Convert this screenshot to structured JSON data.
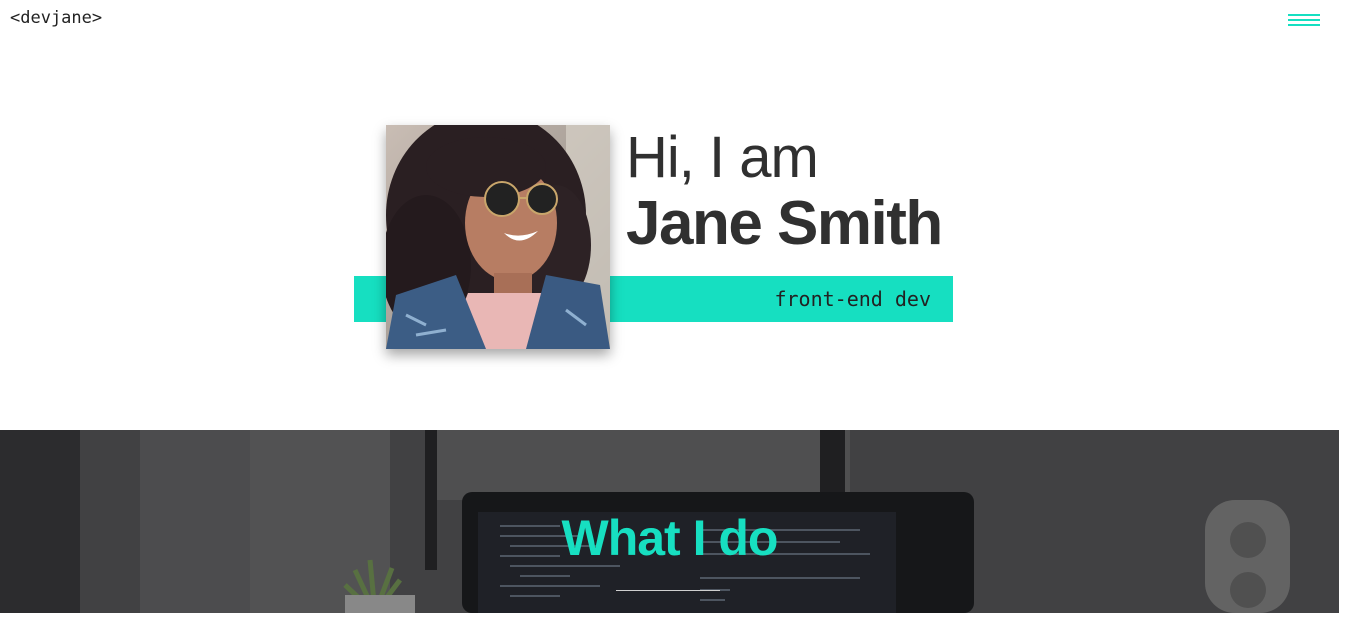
{
  "header": {
    "logo": "<devjane>",
    "menu_icon": "hamburger-menu-icon"
  },
  "hero": {
    "greeting": "Hi, I am",
    "name": "Jane Smith",
    "role": "front-end dev",
    "portrait_alt": "Portrait of Jane Smith",
    "accent_color": "#16dfc1"
  },
  "section": {
    "title": "What I do",
    "title_color": "#17dfc1"
  }
}
